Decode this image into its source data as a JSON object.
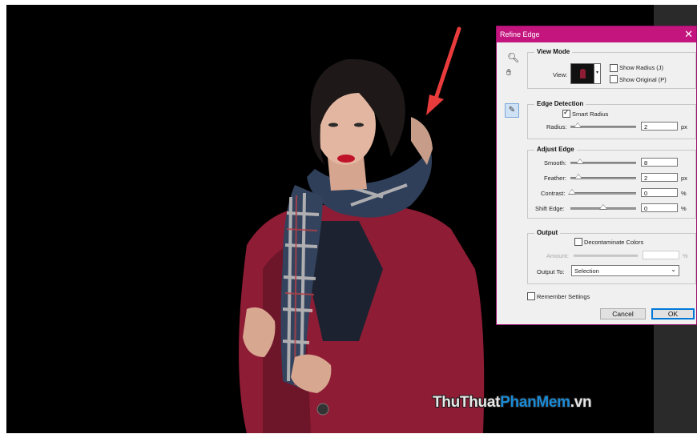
{
  "dialog": {
    "title": "Refine Edge",
    "close_glyph": "✕",
    "view_mode": {
      "legend": "View Mode",
      "view_label": "View:",
      "show_radius": "Show Radius (J)",
      "show_original": "Show Original (P)"
    },
    "edge_detection": {
      "legend": "Edge Detection",
      "smart_radius": "Smart Radius",
      "radius_label": "Radius:",
      "radius_value": "2",
      "radius_unit": "px"
    },
    "adjust_edge": {
      "legend": "Adjust Edge",
      "smooth_label": "Smooth:",
      "smooth_value": "8",
      "feather_label": "Feather:",
      "feather_value": "2",
      "feather_unit": "px",
      "contrast_label": "Contrast:",
      "contrast_value": "0",
      "contrast_unit": "%",
      "shift_label": "Shift Edge:",
      "shift_value": "0",
      "shift_unit": "%"
    },
    "output": {
      "legend": "Output",
      "decontaminate": "Decontaminate Colors",
      "amount_label": "Amount:",
      "amount_unit": "%",
      "output_to_label": "Output To:",
      "output_to_value": "Selection"
    },
    "remember": "Remember Settings",
    "cancel": "Cancel",
    "ok": "OK"
  },
  "watermark": {
    "part_a": "ThuThuat",
    "part_b": "PhanMem",
    "part_c": ".vn"
  },
  "colors": {
    "titlebar": "#c4157e",
    "arrow": "#e83b3b",
    "coat": "#8e1c35"
  }
}
